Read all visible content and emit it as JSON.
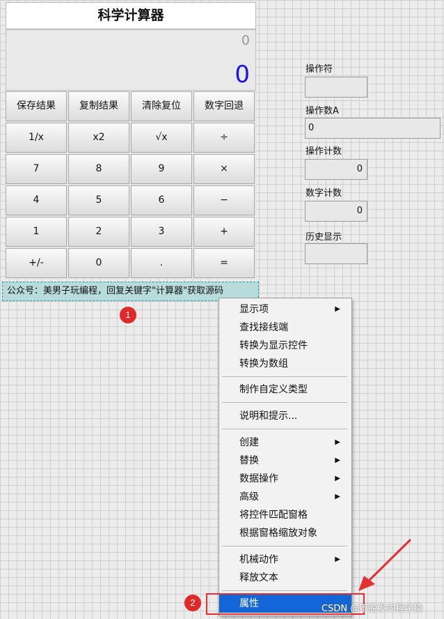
{
  "calculator": {
    "title": "科学计算器",
    "display_secondary": "0",
    "display_main": "0",
    "buttons": [
      [
        "保存结果",
        "复制结果",
        "清除复位",
        "数字回退"
      ],
      [
        "1/x",
        "x2",
        "√x",
        "÷"
      ],
      [
        "7",
        "8",
        "9",
        "×"
      ],
      [
        "4",
        "5",
        "6",
        "−"
      ],
      [
        "1",
        "2",
        "3",
        "+"
      ],
      [
        "+/-",
        "0",
        ".",
        "="
      ]
    ]
  },
  "panel": {
    "operator_label": "操作符",
    "operator_value": "",
    "operand_a_label": "操作数A",
    "operand_a_value": "0",
    "op_count_label": "操作计数",
    "op_count_value": "0",
    "digit_count_label": "数字计数",
    "digit_count_value": "0",
    "history_label": "历史显示",
    "history_value": ""
  },
  "caption": "公众号：美男子玩编程，回复关键字\"计算器\"获取源码",
  "badges": [
    "1",
    "2"
  ],
  "context_menu": {
    "items": [
      {
        "label": "显示项",
        "submenu": true
      },
      {
        "label": "查找接线端",
        "submenu": false
      },
      {
        "label": "转换为显示控件",
        "submenu": false
      },
      {
        "label": "转换为数组",
        "submenu": false
      },
      {
        "label": "制作自定义类型",
        "submenu": false
      },
      {
        "label": "说明和提示...",
        "submenu": false
      },
      {
        "label": "创建",
        "submenu": true
      },
      {
        "label": "替换",
        "submenu": true
      },
      {
        "label": "数据操作",
        "submenu": true
      },
      {
        "label": "高级",
        "submenu": true
      },
      {
        "label": "将控件匹配窗格",
        "submenu": false
      },
      {
        "label": "根据窗格缩放对象",
        "submenu": false
      },
      {
        "label": "机械动作",
        "submenu": true
      },
      {
        "label": "释放文本",
        "submenu": false
      },
      {
        "label": "属性",
        "submenu": false,
        "selected": true
      }
    ],
    "arrow_glyph": "▶"
  },
  "watermark": "CSDN @不脱发的程序猿",
  "colors": {
    "display_main": "#1a12e6",
    "selection": "#1366d6",
    "annotation_red": "#e02a2a",
    "caption_bg": "#b8dcdc"
  }
}
